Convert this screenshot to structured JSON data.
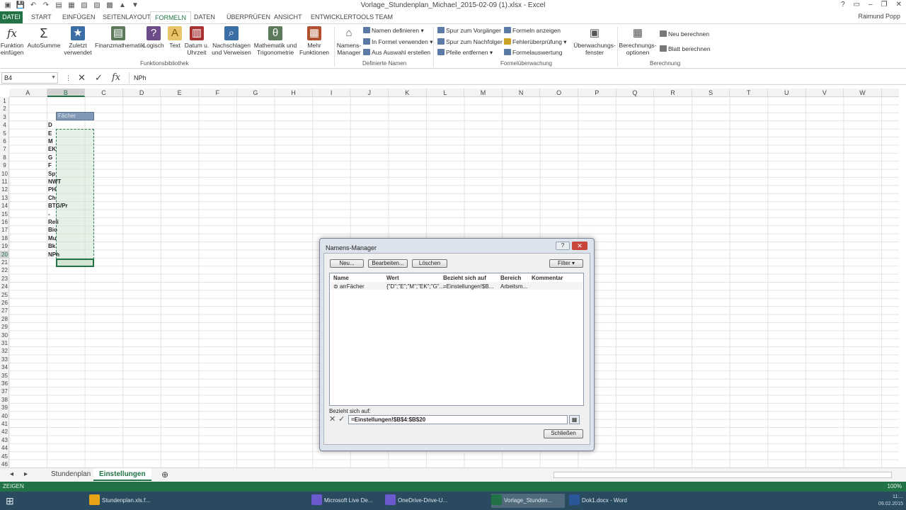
{
  "window": {
    "title": "Vorlage_Stundenplan_Michael_2015-02-09 (1).xlsx - Excel",
    "controls": [
      "?",
      "▭",
      "–",
      "❐",
      "✕"
    ]
  },
  "qat": [
    "▣",
    "💾",
    "↶",
    "↷",
    "▤",
    "▦",
    "▧",
    "▨",
    "▩",
    "▲",
    "▼"
  ],
  "tabs": {
    "file": "DATEI",
    "items": [
      "START",
      "EINFÜGEN",
      "SEITENLAYOUT",
      "FORMELN",
      "DATEN",
      "ÜBERPRÜFEN",
      "ANSICHT",
      "ENTWICKLERTOOLS",
      "TEAM"
    ],
    "active": "FORMELN",
    "user": "Raimund Popp"
  },
  "ribbon": {
    "insert_function": "Funktion\neinfügen",
    "autosum": "AutoSumme",
    "recent": "Zuletzt\nverwendet",
    "financial": "Finanzmathematik",
    "logical": "Logisch",
    "text": "Text",
    "datetime": "Datum u.\nUhrzeit",
    "lookup": "Nachschlagen\nund Verweisen",
    "math": "Mathematik und\nTrigonometrie",
    "more": "Mehr\nFunktionen",
    "group_library": "Funktionsbibliothek",
    "name_manager": "Namens-\nManager",
    "define_name": "Namen definieren",
    "use_in_formula": "In Formel verwenden",
    "create_from_selection": "Aus Auswahl erstellen",
    "group_names": "Definierte Namen",
    "trace_precedents": "Spur zum Vorgänger",
    "trace_dependents": "Spur zum Nachfolger",
    "remove_arrows": "Pfeile entfernen",
    "show_formulas": "Formeln anzeigen",
    "error_checking": "Fehlerüberprüfung",
    "evaluate_formula": "Formelauswertung",
    "group_auditing": "Formelüberwachung",
    "watch_window": "Überwachungs-\nfenster",
    "calc_options": "Berechnungs-\noptionen",
    "calc_now": "Neu berechnen",
    "calc_sheet": "Blatt berechnen",
    "group_calc": "Berechnung"
  },
  "formula_bar": {
    "name_box": "B4",
    "formula": "NPh",
    "cancel": "✕",
    "enter": "✓",
    "fx": "fx"
  },
  "grid": {
    "columns": [
      "A",
      "B",
      "C",
      "D",
      "E",
      "F",
      "G",
      "H",
      "I",
      "J",
      "K",
      "L",
      "M",
      "N",
      "O",
      "P",
      "Q",
      "R",
      "S",
      "T",
      "U",
      "V",
      "W"
    ],
    "selected_column": "B",
    "rows": [
      "1",
      "2",
      "3",
      "4",
      "5",
      "6",
      "7",
      "8",
      "9",
      "10",
      "11",
      "12",
      "13",
      "14",
      "15",
      "16",
      "17",
      "18",
      "19",
      "20",
      "21",
      "22",
      "23",
      "24",
      "25",
      "26",
      "27",
      "28",
      "29",
      "30",
      "31",
      "32",
      "33",
      "34",
      "35",
      "36",
      "37",
      "38",
      "39",
      "40",
      "41",
      "42",
      "43",
      "44",
      "45",
      "46"
    ],
    "selected_row": "20",
    "b2": "Fächer",
    "b_values": [
      "D",
      "E",
      "M",
      "EK",
      "G",
      "F",
      "Sp",
      "NWT",
      "PH",
      "Ch",
      "BTG/Pr",
      "-",
      "Reli",
      "Bio",
      "Mu",
      "Bk",
      "NPh"
    ]
  },
  "sheets": {
    "items": [
      "Stundenplan",
      "Einstellungen"
    ],
    "active": "Einstellungen",
    "add": "⊕",
    "nav": [
      "◂",
      "▸"
    ]
  },
  "status": {
    "mode": "ZEIGEN",
    "zoom": "100%"
  },
  "taskbar": {
    "items": [
      {
        "label": "Stundenplan.xls.f...",
        "color": "#e8a317"
      },
      {
        "label": "Microsoft Live De...",
        "color": "#6a5acd"
      },
      {
        "label": "OneDrive-Drive-U...",
        "color": "#6a5acd"
      },
      {
        "label": "Vorlage_Stunden...",
        "color": "#217346"
      },
      {
        "label": "Dok1.docx - Word",
        "color": "#2b579a"
      }
    ],
    "time": "11:...",
    "date": "09.02.2015"
  },
  "dialog": {
    "title": "Namens-Manager",
    "help": "?",
    "close": "✕",
    "btn_new": "Neu...",
    "btn_edit": "Bearbeiten...",
    "btn_delete": "Löschen",
    "btn_filter": "Filter ▾",
    "columns": [
      "Name",
      "Wert",
      "Bezieht sich auf",
      "Bereich",
      "Kommentar"
    ],
    "row": {
      "name": "arrFächer",
      "value": "{\"D\";\"E\";\"M\";\"EK\";\"G\"...",
      "refers": "=Einstellungen!$B...",
      "scope": "Arbeitsm..."
    },
    "refers_label": "Bezieht sich auf:",
    "refers_value": "=Einstellungen!$B$4:$B$20",
    "btn_close": "Schließen"
  }
}
